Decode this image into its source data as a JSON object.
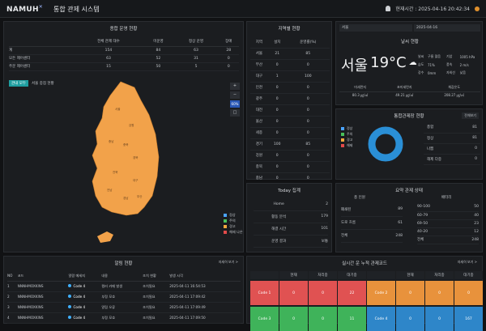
{
  "header": {
    "logo": "NAMUH",
    "title": "통합 관제 시스템",
    "clock_label": "현재시간 : 2025-04-16 20:42:34"
  },
  "overview": {
    "title": "종합 운영 현황",
    "columns": [
      "",
      "전체 관제 대수",
      "미운영",
      "정상 운영",
      "장애"
    ],
    "rows": [
      [
        "계",
        "154",
        "84",
        "63",
        "28"
      ],
      [
        "모든 제어센터",
        "63",
        "52",
        "31",
        "0"
      ],
      [
        "주문 제어센터",
        "15",
        "50",
        "5",
        "0"
      ]
    ]
  },
  "map": {
    "tag": "관내 모두",
    "tag2": "서울 중점 현황",
    "zoom_label": "60%",
    "legend": [
      "정상",
      "주의",
      "경고",
      "해제 나온"
    ],
    "legend_colors": [
      "#4aa3ff",
      "#49c15a",
      "#f2a83e",
      "#e24a4a"
    ]
  },
  "regions": {
    "title": "지역별 현황",
    "columns": [
      "지역",
      "설치",
      "운영률(%)"
    ],
    "rows": [
      [
        "서울",
        "21",
        "85"
      ],
      [
        "부산",
        "0",
        "0"
      ],
      [
        "대구",
        "1",
        "100"
      ],
      [
        "인천",
        "0",
        "0"
      ],
      [
        "광주",
        "0",
        "0"
      ],
      [
        "대전",
        "0",
        "0"
      ],
      [
        "울산",
        "0",
        "0"
      ],
      [
        "세종",
        "0",
        "0"
      ],
      [
        "경기",
        "100",
        "85"
      ],
      [
        "강원",
        "0",
        "0"
      ],
      [
        "충북",
        "0",
        "0"
      ],
      [
        "충남",
        "0",
        "0"
      ]
    ]
  },
  "today": {
    "title": "Today 집계",
    "rows": [
      [
        "Home",
        "2  "
      ],
      [
        "활동 분석",
        "179  "
      ],
      [
        "해결 시간",
        "101  "
      ],
      [
        "운영 결과",
        "보통"
      ]
    ]
  },
  "weather": {
    "region_select": "서울",
    "date_select": "2025-04-16",
    "title": "날씨 현황",
    "city": "서울",
    "temp": "19°C",
    "details": [
      [
        "날씨",
        "구름 많음",
        "기압",
        "1005 hPa"
      ],
      [
        "습도",
        "71%",
        "풍속",
        "2 m/s"
      ],
      [
        "강수",
        "0mm",
        "자외선",
        "낮음"
      ]
    ],
    "air": [
      "미세먼지",
      "초미세먼지",
      "체감온도"
    ],
    "air_vals": [
      "80.3 ㎍/㎥",
      "49.21 ㎍/㎥",
      "208.27 ㎍/㎥"
    ]
  },
  "status": {
    "title": "통합관제장 현황",
    "filter": "전체보기",
    "legend": [
      "정상",
      "주의",
      "경고",
      "해제"
    ],
    "rows": [
      [
        "총합",
        "81",
        "cat"
      ],
      [
        "정상",
        "81",
        "cat"
      ],
      [
        "나쁨",
        "0",
        "cat"
      ],
      [
        "해제 다중",
        "0",
        "cat"
      ]
    ],
    "donut_color": "#2a8fd6"
  },
  "zone": {
    "title": "요약 관제 상태",
    "left_label": "총 인원",
    "right_label": "배터리",
    "left_rows": [
      [
        "폐쇄된",
        "89  "
      ],
      [
        "도로 흐름",
        "61  "
      ],
      [
        "전체",
        "248  "
      ]
    ],
    "right_rows": [
      [
        "90-100",
        "50"
      ],
      [
        "60-79",
        "40"
      ],
      [
        "69-50",
        "23"
      ],
      [
        "40-20",
        "12"
      ],
      [
        "전체",
        "248"
      ]
    ]
  },
  "alarms": {
    "title": "알림 현황",
    "more": "자세히 보기 >",
    "columns": [
      "NO",
      "코드",
      "알람 메세지",
      "내용",
      "조치 현황",
      "발생 시각"
    ],
    "rows": [
      [
        "1",
        "NNNHMOXKINS",
        "Code 4",
        "컬러 카메 발생",
        "조치필요",
        "2025-04-11 16:54:53"
      ],
      [
        "2",
        "NNNHMOXKINS",
        "Code 4",
        "부정 모호",
        "조치필요",
        "2025-04-11 17:09:42"
      ],
      [
        "3",
        "NNNHMOXKINS",
        "Code 4",
        "알림 오류",
        "조치필요",
        "2025-04-11 17:09:49"
      ],
      [
        "4",
        "NNNHMOXKINS",
        "Code 4",
        "부정 모호",
        "조치필요",
        "2025-04-11 17:09:50"
      ]
    ]
  },
  "realtime": {
    "title": "실시간 운 누적 관제코드",
    "more": "자세히 보기 >",
    "headers": [
      "",
      "현재",
      "처리중",
      "대기중",
      "",
      "현재",
      "처리중",
      "대기중"
    ],
    "row1": [
      "Code 1",
      "0",
      "0",
      "22",
      "Code 2",
      "0",
      "0",
      "0"
    ],
    "row2": [
      "Code 3",
      "0",
      "0",
      "11",
      "Code 4",
      "0",
      "0",
      "167"
    ]
  }
}
